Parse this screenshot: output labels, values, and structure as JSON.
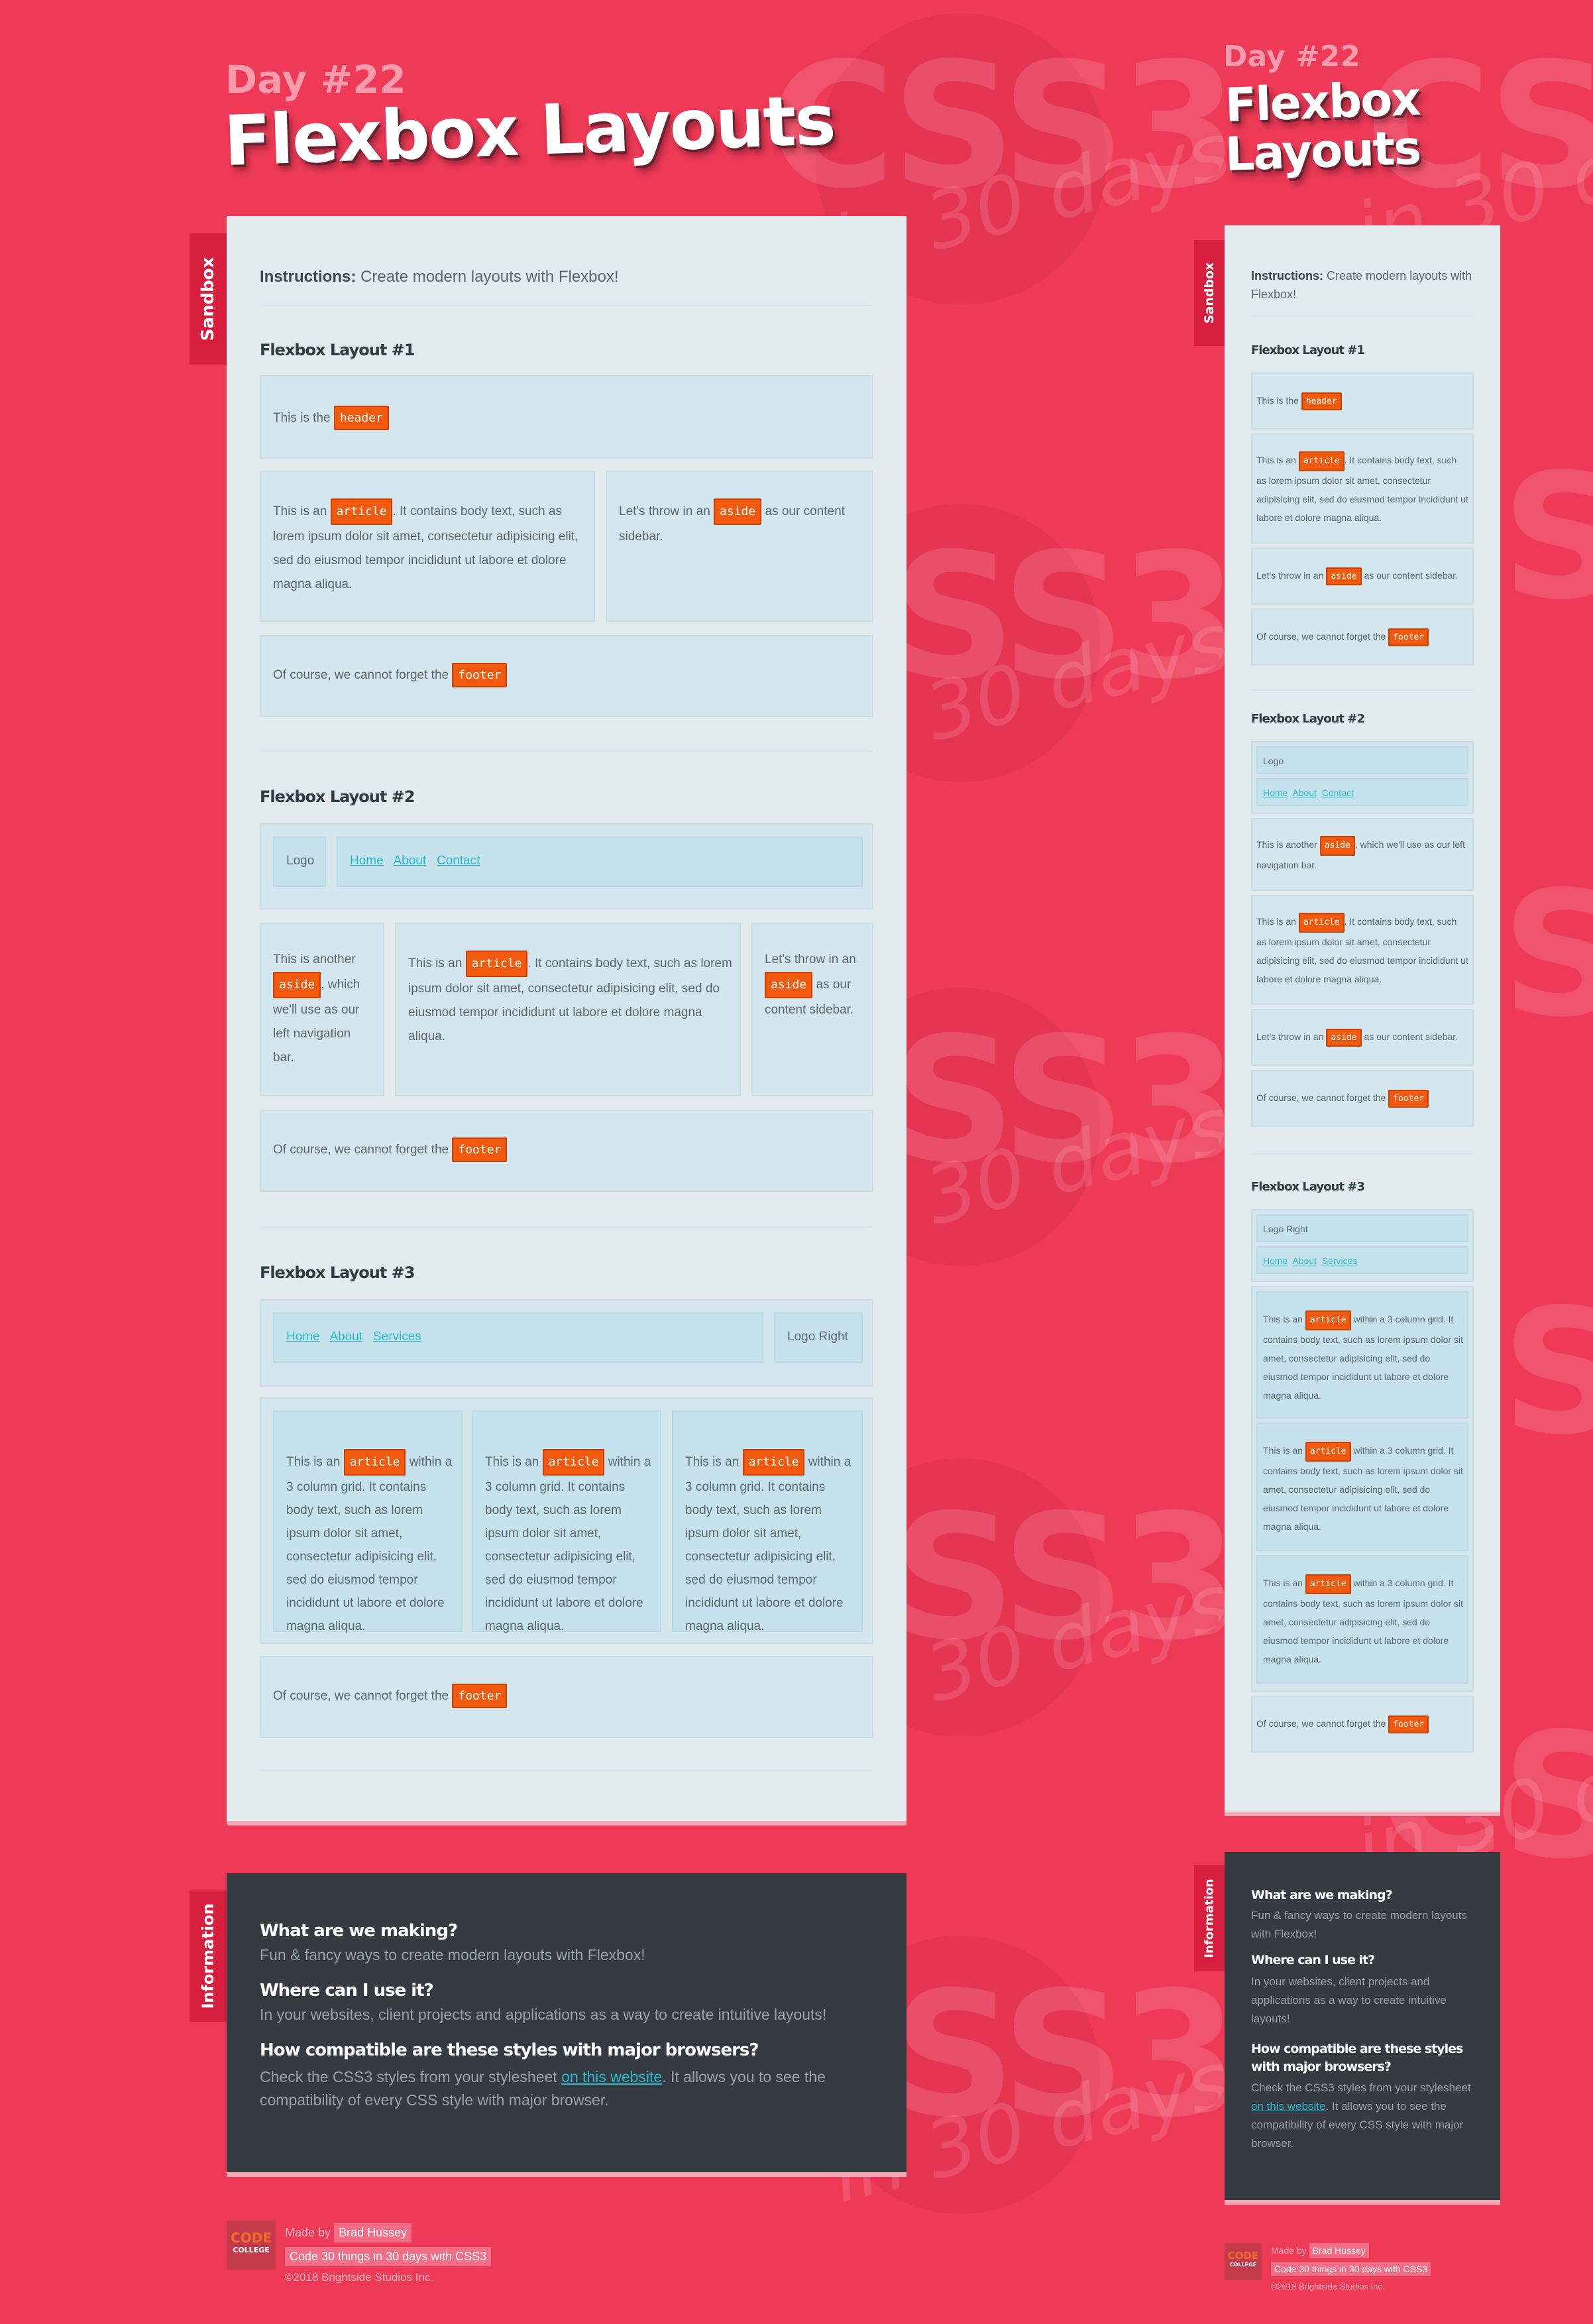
{
  "header": {
    "day_label": "Day #22",
    "title_line1": "Flexbox",
    "title_line2": "Layouts",
    "title_full": "Flexbox Layouts"
  },
  "watermark": {
    "big": "CSS3",
    "small": "in 30 days"
  },
  "tabs": {
    "sandbox": "Sandbox",
    "information": "Information"
  },
  "instructions": {
    "label": "Instructions:",
    "text": "Create modern layouts with Flexbox!"
  },
  "tags": {
    "header": "header",
    "article": "article",
    "aside": "aside",
    "footer": "footer"
  },
  "layout1": {
    "title": "Flexbox Layout #1",
    "header_pre": "This is the",
    "article_pre": "This is an",
    "article_post": ". It contains body text, such as lorem ipsum dolor sit amet, consectetur adipisicing elit, sed do eiusmod tempor incididunt ut labore et dolore magna aliqua.",
    "aside_pre": "Let's throw in an",
    "aside_post": "as our content sidebar.",
    "footer_pre": "Of course, we cannot forget the"
  },
  "layout2": {
    "title": "Flexbox Layout #2",
    "logo": "Logo",
    "nav": [
      "Home",
      "About",
      "Contact"
    ],
    "aside_left_pre": "This is another",
    "aside_left_post": ", which we'll use as our left navigation bar.",
    "article_pre": "This is an",
    "article_post": ". It contains body text, such as lorem ipsum dolor sit amet, consectetur adipisicing elit, sed do eiusmod tempor incididunt ut labore et dolore magna aliqua.",
    "aside_right_pre": "Let's throw in an",
    "aside_right_post": "as our content sidebar.",
    "footer_pre": "Of course, we cannot forget the"
  },
  "layout3": {
    "title": "Flexbox Layout #3",
    "nav": [
      "Home",
      "About",
      "Services"
    ],
    "logo": "Logo Right",
    "article_pre": "This is an",
    "article_post": "within a 3 column grid. It contains body text, such as lorem ipsum dolor sit amet, consectetur adipisicing elit, sed do eiusmod tempor incididunt ut labore et dolore magna aliqua.",
    "footer_pre": "Of course, we cannot forget the"
  },
  "information": {
    "q1": "What are we making?",
    "a1": "Fun & fancy ways to create modern layouts with Flexbox!",
    "q2": "Where can I use it?",
    "a2": "In your websites, client projects and applications as a way to create intuitive layouts!",
    "q3": "How compatible are these styles with major browsers?",
    "a3_pre": "Check the CSS3 styles from your stylesheet",
    "a3_link": "on this website",
    "a3_post": ". It allows you to see the compatibility of every CSS style with major browser."
  },
  "footer": {
    "logo_top": "CODE",
    "logo_bottom": "COLLEGE",
    "made_by": "Made by",
    "author": "Brad Hussey",
    "course": "Code 30 things in 30 days with CSS3",
    "copyright": "©2018 Brightside Studios Inc."
  },
  "colors": {
    "background": "#ee3a57",
    "panel": "#e3ebee",
    "box": "#d4e7ee",
    "tag": "#f15a0e",
    "info": "#353b40",
    "link": "#2bb8ce"
  }
}
